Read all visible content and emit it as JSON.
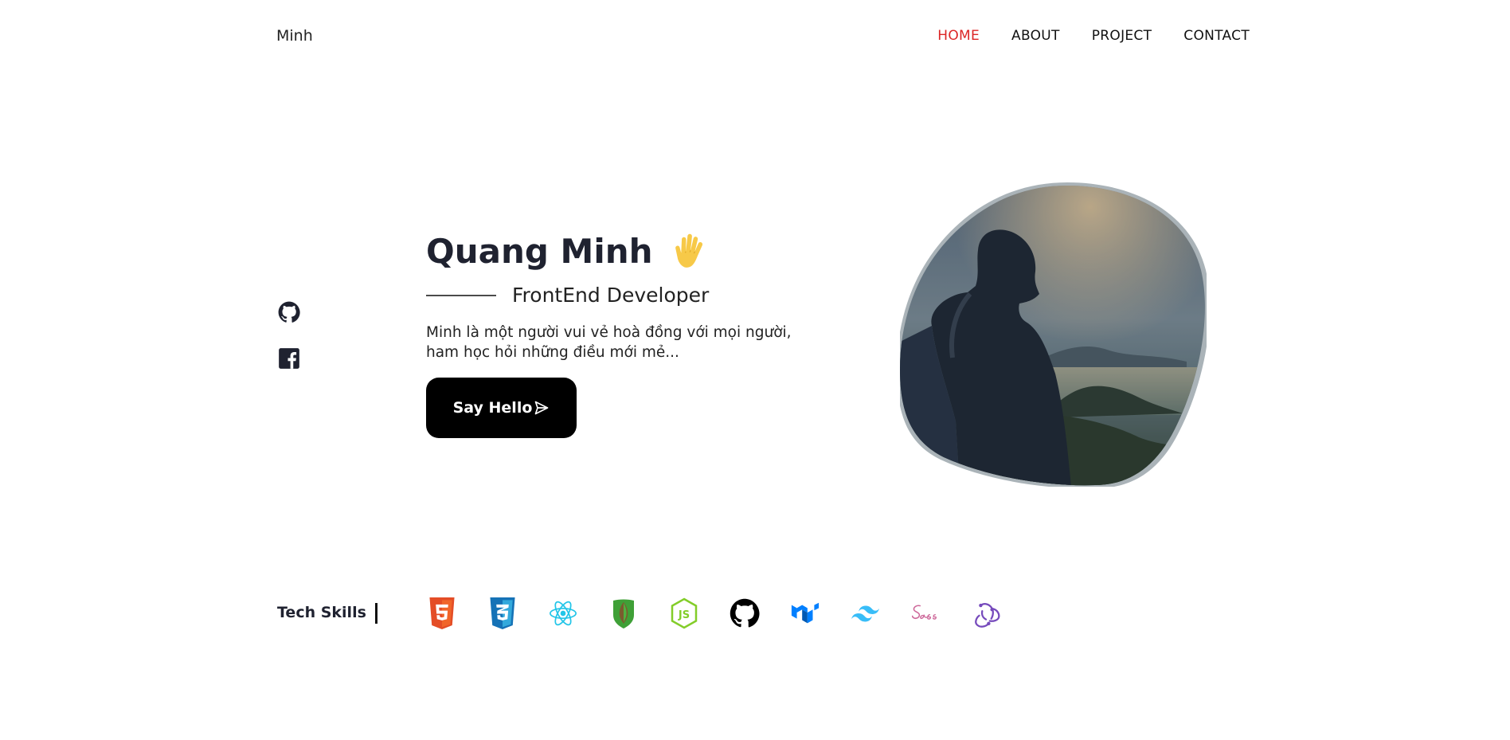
{
  "header": {
    "logo": "Minh",
    "nav": [
      {
        "label": "HOME",
        "active": true
      },
      {
        "label": "ABOUT",
        "active": false
      },
      {
        "label": "PROJECT",
        "active": false
      },
      {
        "label": "CONTACT",
        "active": false
      }
    ]
  },
  "social": [
    {
      "icon": "github-icon"
    },
    {
      "icon": "facebook-icon"
    }
  ],
  "hero": {
    "name": "Quang Minh",
    "wave_icon": "waving-hand-icon",
    "subtitle": "FrontEnd Developer",
    "description": "Minh là một người vui vẻ hoà đồng với mọi người, ham học hỏi những điều mới mẻ...",
    "cta_label": "Say Hello",
    "cta_icon": "send-icon"
  },
  "skills": {
    "label": "Tech Skills",
    "icons": [
      "html5-icon",
      "css3-icon",
      "react-icon",
      "mongodb-icon",
      "nodejs-icon",
      "github-icon",
      "material-ui-icon",
      "tailwind-icon",
      "sass-icon",
      "redux-icon"
    ]
  },
  "colors": {
    "accent": "#dc2626",
    "button_bg": "#000000",
    "text": "#1f2230"
  }
}
